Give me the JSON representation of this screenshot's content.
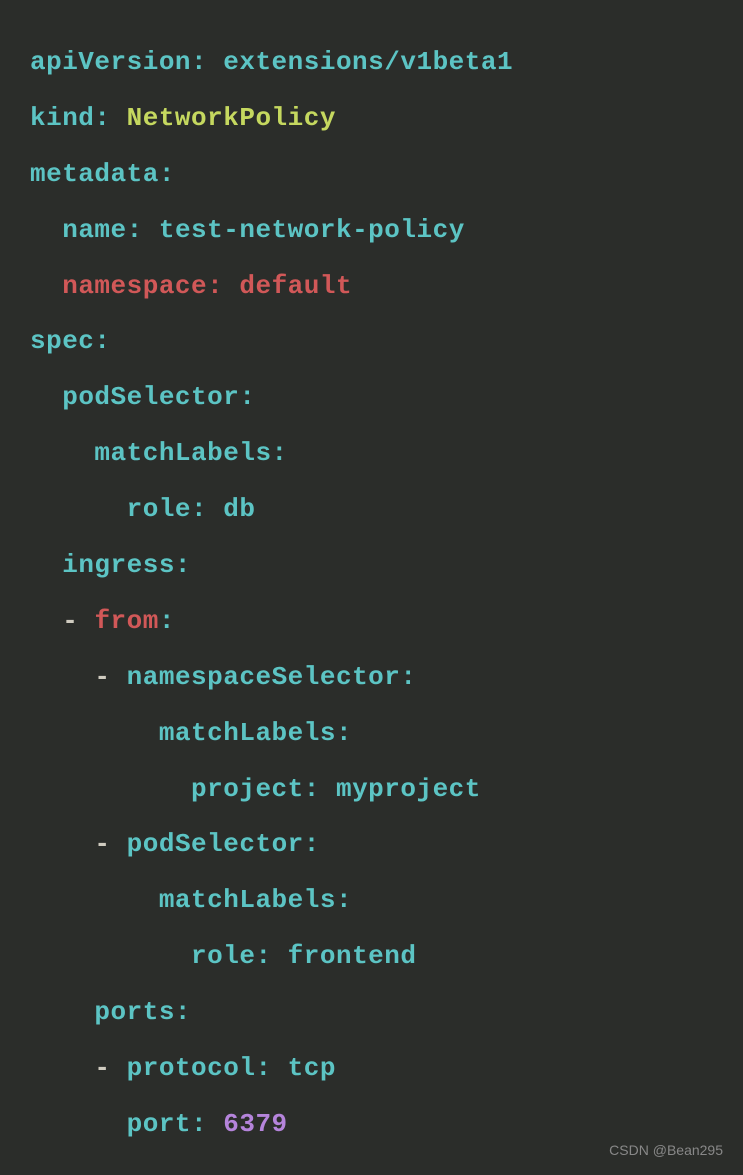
{
  "code": {
    "line1": {
      "key": "apiVersion: ",
      "value": "extensions/v1beta1"
    },
    "line2": {
      "key": "kind: ",
      "value": "NetworkPolicy"
    },
    "line3": {
      "key": "metadata:"
    },
    "line4": {
      "indent": "  ",
      "key": "name: ",
      "value": "test-network-policy"
    },
    "line5": {
      "indent": "  ",
      "key": "namespace: ",
      "value": "default"
    },
    "line6": {
      "key": "spec:"
    },
    "line7": {
      "indent": "  ",
      "key": "podSelector:"
    },
    "line8": {
      "indent": "    ",
      "key": "matchLabels:"
    },
    "line9": {
      "indent": "      ",
      "key": "role: ",
      "value": "db"
    },
    "line10": {
      "indent": "  ",
      "key": "ingress:"
    },
    "line11": {
      "indent": "  ",
      "dash": "- ",
      "key": "from",
      "colon": ":"
    },
    "line12": {
      "indent": "    ",
      "dash": "- ",
      "key": "namespaceSelector:"
    },
    "line13": {
      "indent": "        ",
      "key": "matchLabels:"
    },
    "line14": {
      "indent": "          ",
      "key": "project: ",
      "value": "myproject"
    },
    "line15": {
      "indent": "    ",
      "dash": "- ",
      "key": "podSelector:"
    },
    "line16": {
      "indent": "        ",
      "key": "matchLabels:"
    },
    "line17": {
      "indent": "          ",
      "key": "role: ",
      "value": "frontend"
    },
    "line18": {
      "indent": "    ",
      "key": "ports:"
    },
    "line19": {
      "indent": "    ",
      "dash": "- ",
      "key": "protocol: ",
      "value": "tcp"
    },
    "line20": {
      "indent": "      ",
      "key": "port: ",
      "value": "6379"
    }
  },
  "watermark": "CSDN @Bean295"
}
